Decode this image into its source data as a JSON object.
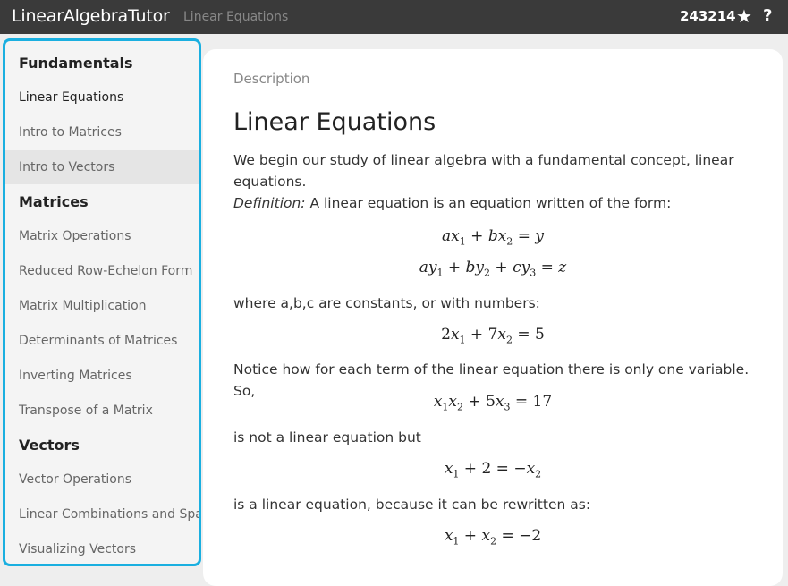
{
  "header": {
    "brand": "LinearAlgebraTutor",
    "breadcrumb": "Linear Equations",
    "score": "243214",
    "star_icon": "star-icon",
    "help_icon": "question-icon"
  },
  "sidebar": {
    "sections": [
      {
        "heading": "Fundamentals",
        "items": [
          "Linear Equations",
          "Intro to Matrices",
          "Intro to Vectors"
        ]
      },
      {
        "heading": "Matrices",
        "items": [
          "Matrix Operations",
          "Reduced Row-Echelon Form",
          "Matrix Multiplication",
          "Determinants of Matrices",
          "Inverting Matrices",
          "Transpose of a Matrix"
        ]
      },
      {
        "heading": "Vectors",
        "items": [
          "Vector Operations",
          "Linear Combinations and Span",
          "Visualizing Vectors"
        ]
      }
    ],
    "active_item": "Linear Equations",
    "hover_item": "Intro to Vectors",
    "highlight_color": "#1aafe0"
  },
  "content": {
    "label": "Description",
    "title": "Linear Equations",
    "intro": "We begin our study of linear algebra with a fundamental concept, linear equations.",
    "definition_term": "Definition:",
    "definition_text": " A linear equation is an equation written of the form:",
    "eq1": "ax1 + bx2 = y",
    "eq2": "ay1 + by2 + cy3 = z",
    "p2": "where a,b,c are constants, or with numbers:",
    "eq3": "2x1 + 7x2 = 5",
    "p3": "Notice how for each term of the linear equation there is only one variable. So,",
    "eq4": "x1x2 + 5x3 = 17",
    "p4": "is not a linear equation but",
    "eq5": "x1 + 2 = −x2",
    "p5": "is a linear equation, because it can be rewritten as:",
    "eq6": "x1 + x2 = −2"
  }
}
